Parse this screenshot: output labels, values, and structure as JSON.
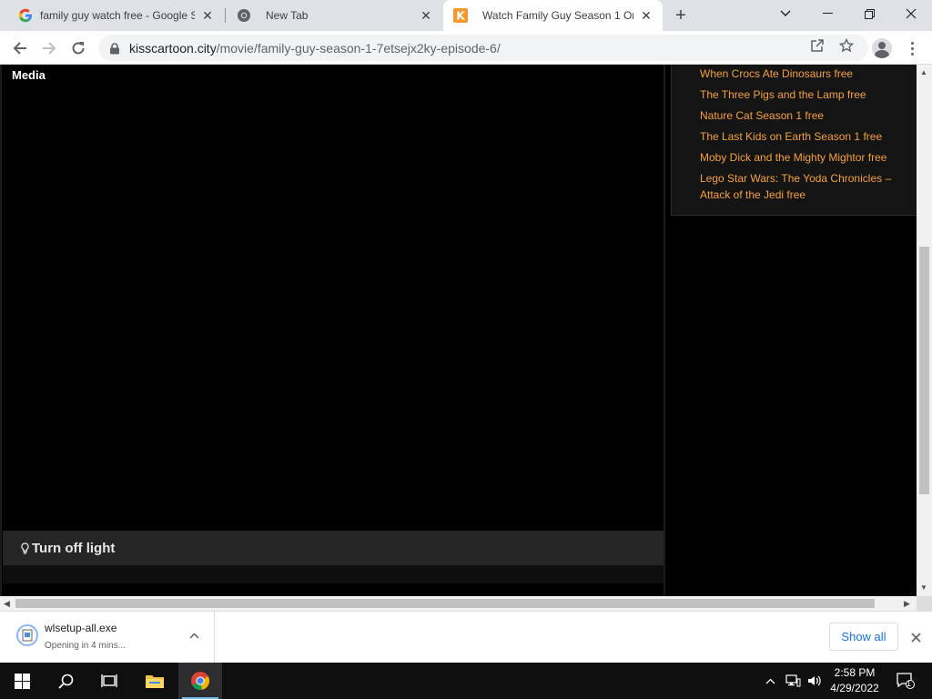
{
  "browser": {
    "tabs": [
      {
        "title": "family guy watch free - Google S",
        "active": false,
        "favicon": "google-g-icon"
      },
      {
        "title": "New Tab",
        "active": false,
        "favicon": "chrome-icon"
      },
      {
        "title": "Watch Family Guy Season 1 Onli",
        "active": true,
        "favicon": "kisscartoon-k-icon"
      }
    ],
    "url_domain": "kisscartoon.city",
    "url_path": "/movie/family-guy-season-1-7etsejx2ky-episode-6/"
  },
  "page": {
    "media_label": "Media",
    "light_button": "Turn off light",
    "sidebar_links": [
      "When Crocs Ate Dinosaurs free",
      "The Three Pigs and the Lamp free",
      "Nature Cat Season 1 free",
      "The Last Kids on Earth Season 1 free",
      "Moby Dick and the Mighty Mightor free",
      "Lego Star Wars: The Yoda Chronicles – Attack of the Jedi free"
    ],
    "link_color": "#f5a03a"
  },
  "downloads": {
    "file_name": "wlsetup-all.exe",
    "status": "Opening in 4 mins...",
    "show_all": "Show all"
  },
  "taskbar": {
    "time": "2:58 PM",
    "date": "4/29/2022",
    "notification_count": "1"
  }
}
